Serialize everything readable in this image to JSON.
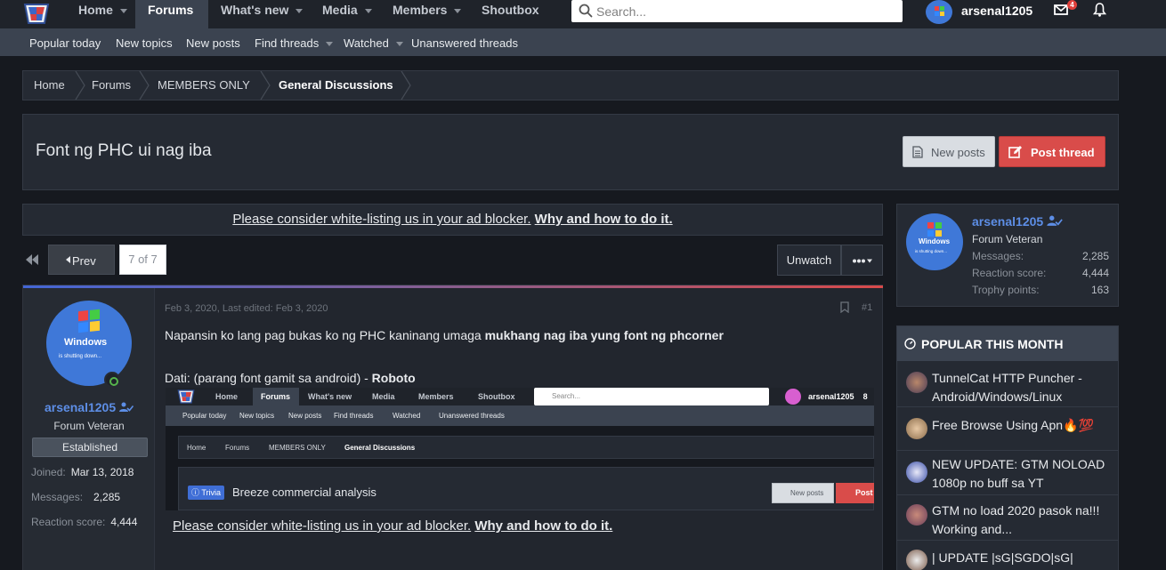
{
  "nav": {
    "tabs": [
      {
        "label": "Home"
      },
      {
        "label": "Forums"
      },
      {
        "label": "What's new"
      },
      {
        "label": "Media"
      },
      {
        "label": "Members"
      },
      {
        "label": "Shoutbox"
      }
    ],
    "search_placeholder": "Search...",
    "username": "arsenal1205",
    "mail_count": "4"
  },
  "subnav": {
    "items": [
      {
        "label": "Popular today"
      },
      {
        "label": "New topics"
      },
      {
        "label": "New posts"
      },
      {
        "label": "Find threads"
      },
      {
        "label": "Watched"
      },
      {
        "label": "Unanswered threads"
      }
    ]
  },
  "breadcrumb": [
    "Home",
    "Forums",
    "MEMBERS ONLY",
    "General Discussions"
  ],
  "thread": {
    "title": "Font ng PHC ui nag iba",
    "new_posts_label": "New posts",
    "post_thread_label": "Post thread"
  },
  "ad": {
    "link_text": "Please consider white-listing us in your ad blocker.",
    "bold_text": "Why and how to do it."
  },
  "pagination": {
    "prev_label": "Prev",
    "current": "7 of 7",
    "unwatch_label": "Unwatch"
  },
  "post": {
    "avatar_text": "Windows",
    "avatar_sub": "is shutting down...",
    "username": "arsenal1205",
    "user_title": "Forum Veteran",
    "badge": "Established",
    "joined_label": "Joined:",
    "joined": "Mar 13, 2018",
    "messages_label": "Messages:",
    "messages": "2,285",
    "reaction_label": "Reaction score:",
    "reaction": "4,444",
    "date": "Feb 3, 2020",
    "edited": "Last edited: Feb 3, 2020",
    "number": "#1",
    "line1_plain": "Napansin ko lang pag bukas ko ng PHC kaninang umaga ",
    "line1_bold": "mukhang nag iba yung font ng phcorner",
    "line2_plain": "Dati: (parang font gamit sa android) - ",
    "line2_bold": "Roboto"
  },
  "embedded": {
    "tabs": [
      "Home",
      "Forums",
      "What's new",
      "Media",
      "Members",
      "Shoutbox"
    ],
    "search": "Search...",
    "user": "arsenal1205",
    "user_extra": "8",
    "subnav": [
      "Popular today",
      "New topics",
      "New posts",
      "Find threads",
      "Watched",
      "Unanswered threads"
    ],
    "crumbs": [
      "Home",
      "Forums",
      "MEMBERS ONLY",
      "General Discussions"
    ],
    "trivia": "Trivia",
    "analysis": "Breeze commercial analysis",
    "new_posts": "New posts",
    "post": "Post"
  },
  "sidebar_user": {
    "name": "arsenal1205",
    "title": "Forum Veteran",
    "messages_label": "Messages:",
    "messages": "2,285",
    "reaction_label": "Reaction score:",
    "reaction": "4,444",
    "trophy_label": "Trophy points:",
    "trophy": "163"
  },
  "popular": {
    "title": "POPULAR THIS MONTH",
    "items": [
      {
        "title": "TunnelCat HTTP Puncher - Android/Windows/Linux"
      },
      {
        "title": "Free Browse Using Apn🔥💯"
      },
      {
        "title": "NEW UPDATE: GTM NOLOAD 1080p no buff sa YT"
      },
      {
        "title": "GTM no load 2020 pasok na!!! Working and..."
      },
      {
        "title": "| UPDATE |sG|SGDO|sG|"
      }
    ]
  },
  "colors": {
    "accent_blue": "#5d8ee6",
    "post_thread_red": "#d94c4a",
    "online_green": "#56b44d"
  }
}
